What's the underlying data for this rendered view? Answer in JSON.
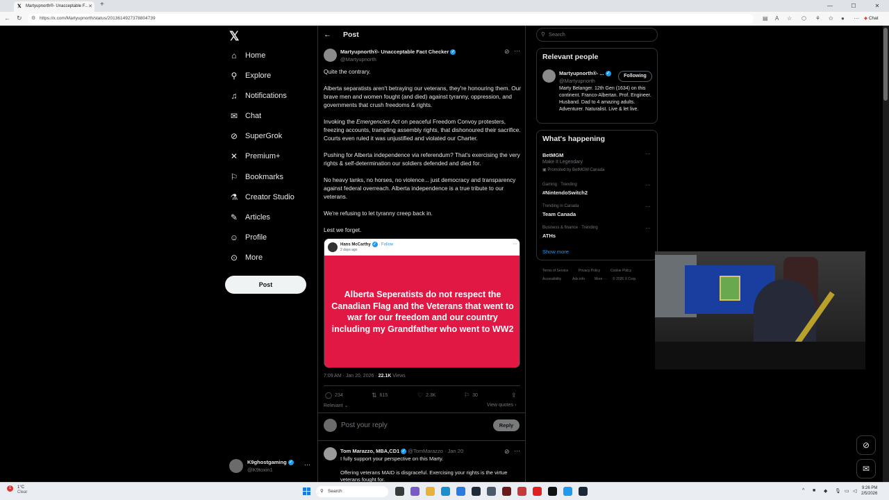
{
  "browser": {
    "tab_title": "Martyupnorth®- Unacceptable F...",
    "url": "https://x.com/Martyupnorth/status/2013614927378804739",
    "chat_label": "Chat"
  },
  "nav": {
    "items": [
      {
        "label": "Home",
        "icon": "home-icon"
      },
      {
        "label": "Explore",
        "icon": "search-icon"
      },
      {
        "label": "Notifications",
        "icon": "bell-icon"
      },
      {
        "label": "Chat",
        "icon": "mail-icon"
      },
      {
        "label": "SuperGrok",
        "icon": "grok-icon"
      },
      {
        "label": "Premium+",
        "icon": "x-icon"
      },
      {
        "label": "Bookmarks",
        "icon": "bookmark-icon"
      },
      {
        "label": "Creator Studio",
        "icon": "flask-icon"
      },
      {
        "label": "Articles",
        "icon": "article-icon"
      },
      {
        "label": "Profile",
        "icon": "person-icon"
      },
      {
        "label": "More",
        "icon": "more-circle-icon"
      }
    ],
    "post_button": "Post",
    "account_name": "K9ghostgaming",
    "account_handle": "@K9toxin1"
  },
  "post": {
    "heading": "Post",
    "author_name": "Martyupnorth®- Unacceptable Fact Checker",
    "author_handle": "@Martyupnorth",
    "p1": "Quite the contrary.",
    "p2": "Alberta separatists aren't betraying our veterans, they're honouring them.  Our brave men and women fought (and died) against tyranny, oppression, and governments that crush freedoms & rights.",
    "p3_pre": "Invoking the ",
    "p3_em": "Emergencies Act",
    "p3_post": " on peaceful Freedom Convoy protesters, freezing accounts, trampling assembly rights,  that dishonoured their sacrifice.  Courts even ruled it was unjustified and violated our Charter.",
    "p4": "Pushing for Alberta independence via referendum? That's exercising the very rights & self-determination our soldiers defended and died for.",
    "p5": "No heavy tanks, no horses, no violence... just democracy and transparency against federal overreach.  Alberta independence is a true tribute to our veterans.",
    "p6": "We're refusing to let tyranny creep back in.",
    "p7": "Lest we forget.",
    "quote": {
      "name": "Hans McCarthy",
      "follow": "· Follow",
      "time": "2 days ago",
      "image_text": "Alberta Seperatists do not respect the Canadian Flag and the Veterans that went to war for our freedom and our country including my Grandfather who went to WW2"
    },
    "timestamp": "7:09 AM · Jan 20, 2026 · ",
    "views_count": "22.1K",
    "views_label": " Views",
    "stats": {
      "replies": "234",
      "reposts": "615",
      "likes": "2.3K",
      "bookmarks": "30"
    },
    "sort_label": "Relevant",
    "view_quotes": "View quotes",
    "reply_placeholder": "Post your reply",
    "reply_button": "Reply"
  },
  "comment": {
    "name": "Tom Marazzo, MBA,CD1",
    "handle": "@TomMarazzo · Jan 20",
    "line1": "I fully support your perspective on this Marty.",
    "line2": "Offering veterans MAID is disgraceful.  Exercising your rights is the virtue veterans fought for."
  },
  "sidebar": {
    "search_placeholder": "Search",
    "relevant_title": "Relevant people",
    "person_name": "Martyupnorth®- ...",
    "person_handle": "@Martyupnorth",
    "following_label": "Following",
    "person_bio": "Marty Belanger. 12th Gen (1634) on this continent. Franco-Albertan. Prof. Engineer. Husband. Dad to 4 amazing adults. Adventurer. Naturalist. Live & let live.",
    "happening_title": "What's happening",
    "trends": [
      {
        "context": "",
        "name": "BetMGM",
        "sub1": "Make It Legendary",
        "sub2": "Promoted by BetMGM Canada"
      },
      {
        "context": "Gaming · Trending",
        "name": "#NintendoSwitch2"
      },
      {
        "context": "Trending in Canada",
        "name": "Team Canada"
      },
      {
        "context": "Business & finance · Trending",
        "name": "ATHs"
      }
    ],
    "show_more": "Show more",
    "footer": [
      "Terms of Service",
      "Privacy Policy",
      "Cookie Policy",
      "Accessibility",
      "Ads info",
      "More ···",
      "© 2026 X Corp."
    ]
  },
  "taskbar": {
    "temp": "1°C",
    "weather": "Clear",
    "weather_badge": "1",
    "search": "Search",
    "time": "9:26 PM",
    "date": "2/5/2026"
  },
  "colors": {
    "accent": "#1d9bf0",
    "quote_bg": "#e11843",
    "background": "#000000"
  }
}
